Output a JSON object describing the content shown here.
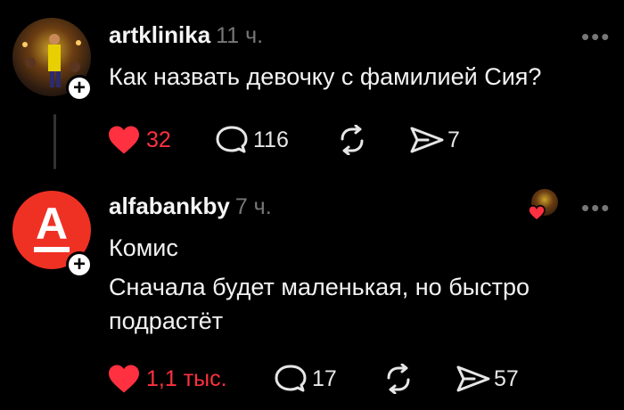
{
  "post1": {
    "username": "artklinika",
    "time": "11 ч.",
    "text": "Как назвать девочку с фамилией Сия?",
    "likes": "32",
    "comments": "116",
    "shares": "7",
    "more": "•••"
  },
  "post2": {
    "username": "alfabankby",
    "time": "7 ч.",
    "avatar_letter": "А",
    "text_line1": "Комис",
    "text_line2": "Сначала будет маленькая, но быстро",
    "text_line3": "подрастёт",
    "likes": "1,1 тыс.",
    "comments": "17",
    "shares": "57",
    "more": "•••"
  },
  "colors": {
    "like_red": "#ff3040",
    "alfa_red": "#ef3124",
    "muted": "#777777"
  },
  "icons": [
    "heart-icon",
    "comment-icon",
    "repost-icon",
    "share-icon",
    "plus-icon",
    "more-icon"
  ]
}
